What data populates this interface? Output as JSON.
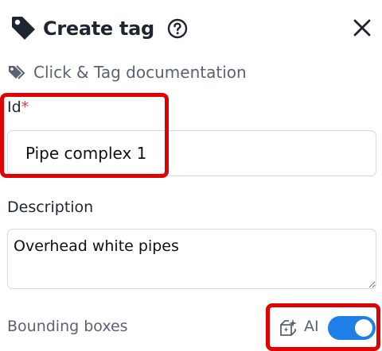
{
  "header": {
    "title": "Create tag",
    "tag_icon": "tag-icon",
    "help_icon": "question-circle-icon",
    "close_icon": "close-icon"
  },
  "documentation": {
    "icon": "tags-icon",
    "label": "Click & Tag documentation"
  },
  "fields": {
    "id": {
      "label": "Id",
      "required_mark": "*",
      "value": "Pipe complex 1"
    },
    "description": {
      "label": "Description",
      "value": "Overhead white pipes"
    }
  },
  "bounding_boxes": {
    "label": "Bounding boxes",
    "ai_icon": "ai-box-sparkle-icon",
    "ai_label": "AI",
    "ai_enabled": true
  },
  "colors": {
    "highlight": "#e00000",
    "toggle_on": "#1e7fe6",
    "required": "#e53935"
  }
}
